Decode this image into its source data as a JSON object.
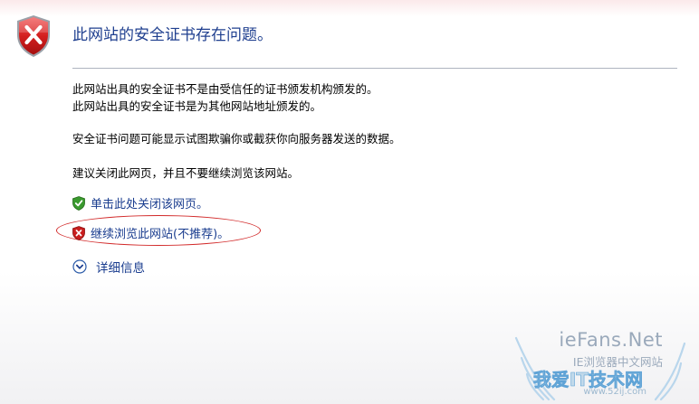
{
  "header": {
    "title": "此网站的安全证书存在问题。"
  },
  "message": {
    "line1": "此网站出具的安全证书不是由受信任的证书颁发机构颁发的。",
    "line2": "此网站出具的安全证书是为其他网站地址颁发的。",
    "line3": "安全证书问题可能显示试图欺骗你或截获你向服务器发送的数据。",
    "line4": "建议关闭此网页，并且不要继续浏览该网站。"
  },
  "actions": {
    "close_label": "单击此处关闭该网页。",
    "continue_label": "继续浏览此网站(不推荐)。",
    "details_label": "详细信息"
  },
  "watermark": {
    "title": "ieFans.Net",
    "subtitle": "IE浏览器中文网站",
    "brand": "我爱IT技术网",
    "url": "www.52ij.com"
  },
  "icons": {
    "header": "error-shield-icon",
    "close": "green-check-shield-icon",
    "continue": "red-x-shield-icon",
    "details": "chevron-down-circle-icon"
  },
  "colors": {
    "title": "#1f3f8f",
    "link": "#1a3d8f",
    "annotation": "#d22a2a",
    "error_red": "#c91e1e",
    "safe_green": "#3a9a2e"
  }
}
